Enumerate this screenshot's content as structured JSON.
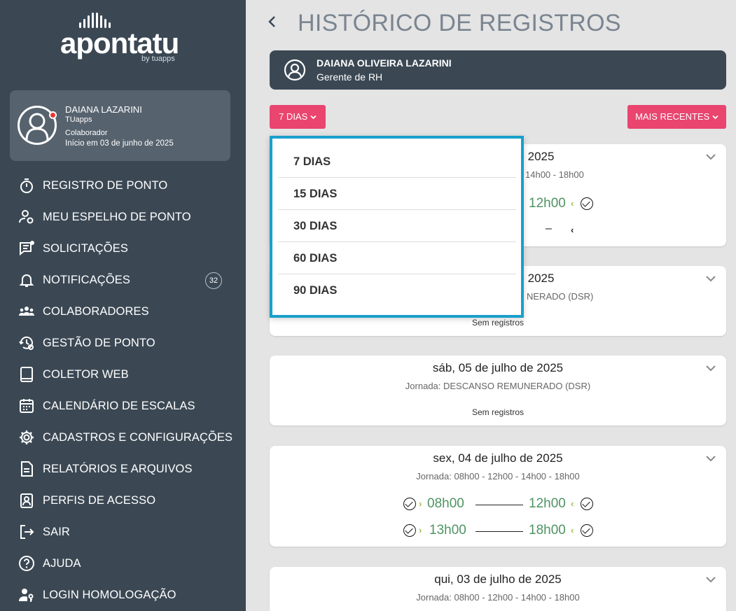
{
  "brand": {
    "name": "apontatu",
    "byline": "by tuapps"
  },
  "profile": {
    "name": "DAIANA LAZARINI",
    "company": "TUapps",
    "role": "Colaborador",
    "start": "Início em 03 de junho de 2025"
  },
  "nav": [
    {
      "label": "REGISTRO DE PONTO",
      "icon": "stopwatch-icon"
    },
    {
      "label": "MEU ESPELHO DE PONTO",
      "icon": "user-settings-icon"
    },
    {
      "label": "SOLICITAÇÕES",
      "icon": "chat-icon"
    },
    {
      "label": "NOTIFICAÇÕES",
      "icon": "bell-icon",
      "badge": "32"
    },
    {
      "label": "COLABORADORES",
      "icon": "team-icon"
    },
    {
      "label": "GESTÃO DE PONTO",
      "icon": "history-gear-icon"
    },
    {
      "label": "COLETOR WEB",
      "icon": "tablet-icon"
    },
    {
      "label": "CALENDÁRIO DE ESCALAS",
      "icon": "calendar-icon"
    },
    {
      "label": "CADASTROS E CONFIGURAÇÕES",
      "icon": "gear-icon"
    },
    {
      "label": "RELATÓRIOS E ARQUIVOS",
      "icon": "document-icon"
    },
    {
      "label": "PERFIS DE ACESSO",
      "icon": "id-badge-icon"
    },
    {
      "label": "SAIR",
      "icon": "logout-icon"
    },
    {
      "label": "AJUDA",
      "icon": "help-icon"
    },
    {
      "label": "LOGIN HOMOLOGAÇÃO",
      "icon": "user-key-icon"
    }
  ],
  "page": {
    "title": "HISTÓRICO DE REGISTROS",
    "back_icon": "chevron-left-icon"
  },
  "user_banner": {
    "name": "DAIANA OLIVEIRA LAZARINI",
    "role": "Gerente de RH"
  },
  "filters": {
    "days_label": "7 DIAS",
    "sort_label": "MAIS RECENTES",
    "days_options": [
      "7 DIAS",
      "15 DIAS",
      "30 DIAS",
      "60 DIAS",
      "90 DIAS"
    ]
  },
  "cards": [
    {
      "date_partial": "de 2025",
      "sub_partial": "14h00 - 18h00",
      "row1_time": "12h00",
      "row2_dash": "–"
    },
    {
      "date_partial": "de 2025",
      "sub_partial": "NERADO (DSR)",
      "empty": "Sem registros"
    },
    {
      "date": "sáb, 05 de julho de 2025",
      "sub": "Jornada: DESCANSO REMUNERADO (DSR)",
      "empty": "Sem registros"
    },
    {
      "date": "sex, 04 de julho de 2025",
      "sub": "Jornada: 08h00 - 12h00 - 14h00 - 18h00",
      "punches": [
        {
          "in": "08h00",
          "out": "12h00"
        },
        {
          "in": "13h00",
          "out": "18h00"
        }
      ]
    },
    {
      "date": "qui, 03 de julho de 2025",
      "sub": "Jornada: 08h00 - 12h00 - 14h00 - 18h00"
    }
  ],
  "colors": {
    "sidebar": "#3b4854",
    "accent": "#e9456f",
    "time_green": "#4e9462",
    "dropdown_border": "#1aa0cb"
  }
}
